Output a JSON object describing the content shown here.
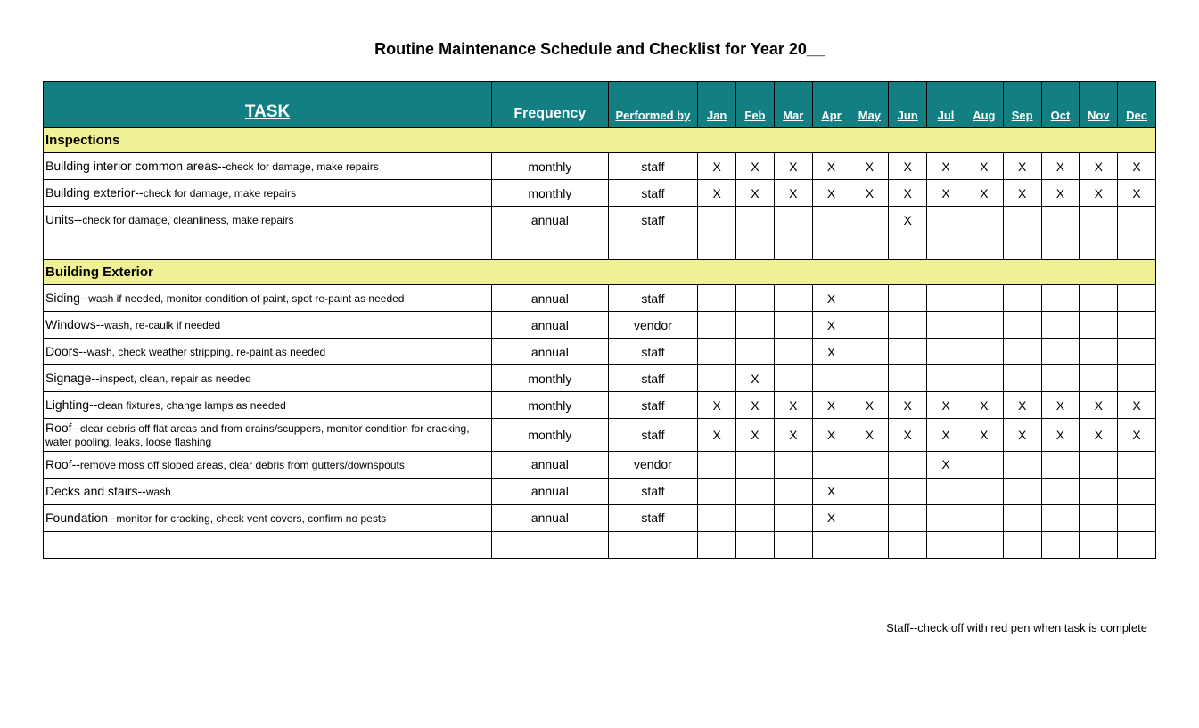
{
  "title": "Routine Maintenance Schedule and Checklist for Year 20__",
  "headers": {
    "task": "TASK",
    "frequency": "Frequency",
    "performed_by": "Performed by",
    "months": [
      "Jan",
      "Feb",
      "Mar",
      "Apr",
      "May",
      "Jun",
      "Jul",
      "Aug",
      "Sep",
      "Oct",
      "Nov",
      "Dec"
    ]
  },
  "sections": [
    {
      "name": "Inspections",
      "rows": [
        {
          "task_main": "Building interior common areas--",
          "task_detail": "check for damage, make repairs",
          "frequency": "monthly",
          "performed_by": "staff",
          "months": [
            "X",
            "X",
            "X",
            "X",
            "X",
            "X",
            "X",
            "X",
            "X",
            "X",
            "X",
            "X"
          ]
        },
        {
          "task_main": "Building exterior--",
          "task_detail": "check for damage, make repairs",
          "frequency": "monthly",
          "performed_by": "staff",
          "months": [
            "X",
            "X",
            "X",
            "X",
            "X",
            "X",
            "X",
            "X",
            "X",
            "X",
            "X",
            "X"
          ]
        },
        {
          "task_main": "Units--",
          "task_detail": "check for damage, cleanliness, make repairs",
          "frequency": "annual",
          "performed_by": "staff",
          "months": [
            "",
            "",
            "",
            "",
            "",
            "X",
            "",
            "",
            "",
            "",
            "",
            ""
          ]
        },
        {
          "empty": true
        }
      ]
    },
    {
      "name": "Building Exterior",
      "rows": [
        {
          "task_main": "Siding--",
          "task_detail": "wash if needed, monitor condition of paint, spot re-paint as needed",
          "frequency": "annual",
          "performed_by": "staff",
          "months": [
            "",
            "",
            "",
            "X",
            "",
            "",
            "",
            "",
            "",
            "",
            "",
            ""
          ]
        },
        {
          "task_main": "Windows--",
          "task_detail": "wash, re-caulk if needed",
          "frequency": "annual",
          "performed_by": "vendor",
          "months": [
            "",
            "",
            "",
            "X",
            "",
            "",
            "",
            "",
            "",
            "",
            "",
            ""
          ]
        },
        {
          "task_main": "Doors--",
          "task_detail": "wash, check weather stripping, re-paint as needed",
          "frequency": "annual",
          "performed_by": "staff",
          "months": [
            "",
            "",
            "",
            "X",
            "",
            "",
            "",
            "",
            "",
            "",
            "",
            ""
          ]
        },
        {
          "task_main": "Signage--",
          "task_detail": "inspect, clean, repair as needed",
          "frequency": "monthly",
          "performed_by": "staff",
          "months": [
            "",
            "X",
            "",
            "",
            "",
            "",
            "",
            "",
            "",
            "",
            "",
            ""
          ]
        },
        {
          "task_main": "Lighting--",
          "task_detail": "clean fixtures, change lamps as needed",
          "frequency": "monthly",
          "performed_by": "staff",
          "months": [
            "X",
            "X",
            "X",
            "X",
            "X",
            "X",
            "X",
            "X",
            "X",
            "X",
            "X",
            "X"
          ]
        },
        {
          "task_main": "Roof--",
          "task_detail": "clear debris off flat areas and from drains/scuppers, monitor condition for cracking, water pooling, leaks, loose flashing",
          "frequency": "monthly",
          "performed_by": "staff",
          "months": [
            "X",
            "X",
            "X",
            "X",
            "X",
            "X",
            "X",
            "X",
            "X",
            "X",
            "X",
            "X"
          ]
        },
        {
          "task_main": "Roof--",
          "task_detail": "remove moss off sloped areas, clear debris from gutters/downspouts",
          "frequency": "annual",
          "performed_by": "vendor",
          "months": [
            "",
            "",
            "",
            "",
            "",
            "",
            "X",
            "",
            "",
            "",
            "",
            ""
          ]
        },
        {
          "task_main": "Decks and stairs--",
          "task_detail": "wash",
          "frequency": "annual",
          "performed_by": "staff",
          "months": [
            "",
            "",
            "",
            "X",
            "",
            "",
            "",
            "",
            "",
            "",
            "",
            ""
          ]
        },
        {
          "task_main": "Foundation--",
          "task_detail": "monitor for cracking, check vent covers, confirm no pests",
          "frequency": "annual",
          "performed_by": "staff",
          "months": [
            "",
            "",
            "",
            "X",
            "",
            "",
            "",
            "",
            "",
            "",
            "",
            ""
          ]
        },
        {
          "empty": true
        }
      ]
    }
  ],
  "footnote": "Staff--check off with red pen when task is complete"
}
